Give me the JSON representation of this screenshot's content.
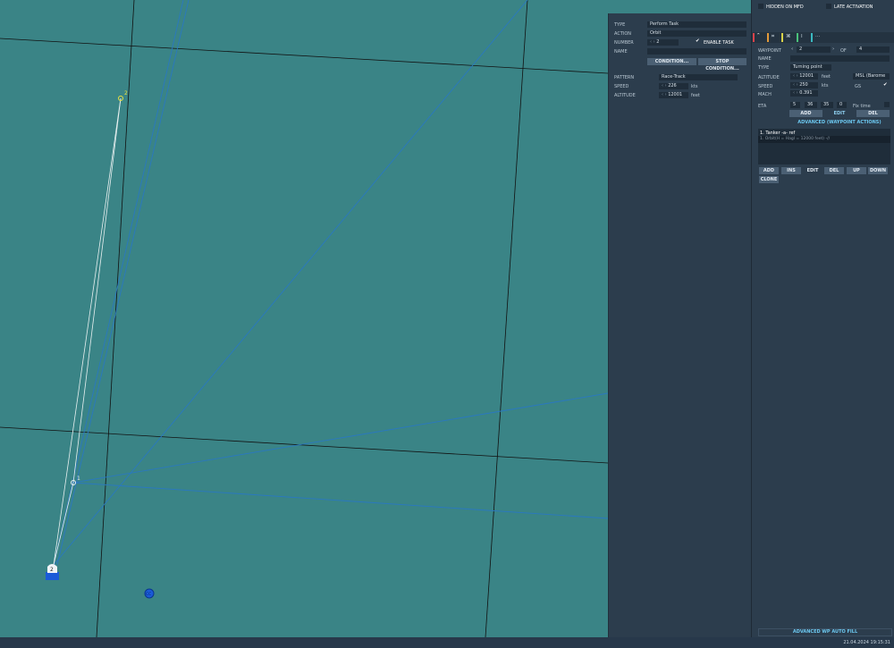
{
  "map": {
    "waypoints": [
      {
        "label": "1"
      },
      {
        "label": "2"
      }
    ],
    "unit_label": "2",
    "marker_label": "CC"
  },
  "task": {
    "type_label": "TYPE",
    "type_value": "Perform Task",
    "action_label": "ACTION",
    "action_value": "Orbit",
    "number_label": "NUMBER",
    "number_value": "2",
    "enable_task": "ENABLE TASK",
    "enable_checked": true,
    "name_label": "NAME",
    "name_value": "",
    "condition": "CONDITION...",
    "stop_condition": "STOP CONDITION...",
    "pattern_label": "PATTERN",
    "pattern_value": "Race-Track",
    "speed_label": "SPEED",
    "speed_value": "226",
    "speed_unit": "kts",
    "altitude_label": "ALTITUDE",
    "altitude_value": "12001",
    "altitude_unit": "feet"
  },
  "wp": {
    "hidden_on_mfd": "HIDDEN ON MFD",
    "late_activation": "LATE ACTIVATION",
    "tab_colors": [
      "#d9434a",
      "#e39a3a",
      "#d9d34a",
      "#4ac07a",
      "#3ab8c0"
    ],
    "waypoint_label": "WAYPOINT",
    "waypoint_value": "2",
    "of_label": "OF",
    "of_value": "4",
    "name_label": "NAME",
    "type_label": "TYPE",
    "type_value": "Turning point",
    "altitude_label": "ALTITUDE",
    "altitude_value": "12001",
    "altitude_unit": "feet",
    "altitude_ref": "MSL (Barome",
    "speed_label": "SPEED",
    "speed_value": "250",
    "speed_unit": "kts",
    "gs_label": "GS",
    "mach_label": "MACH",
    "mach_value": "0.391",
    "eta_label": "ETA",
    "eta": [
      "5",
      "36",
      "35",
      "0"
    ],
    "fix_time": "Fix time",
    "add": "ADD",
    "edit": "EDIT",
    "del": "DEL",
    "advanced": "ADVANCED (WAYPOINT ACTIONS)",
    "actions": [
      "1. Tanker -a- ref",
      "1. Orbit(H = Hagl = 12000 feet) -//"
    ],
    "list_buttons": [
      "ADD",
      "INS",
      "EDIT",
      "DEL",
      "UP",
      "DOWN"
    ],
    "clone": "CLONE",
    "auto_fill": "ADVANCED WP AUTO FILL"
  },
  "status": {
    "datetime": "21.04.2024 19:15:31"
  }
}
